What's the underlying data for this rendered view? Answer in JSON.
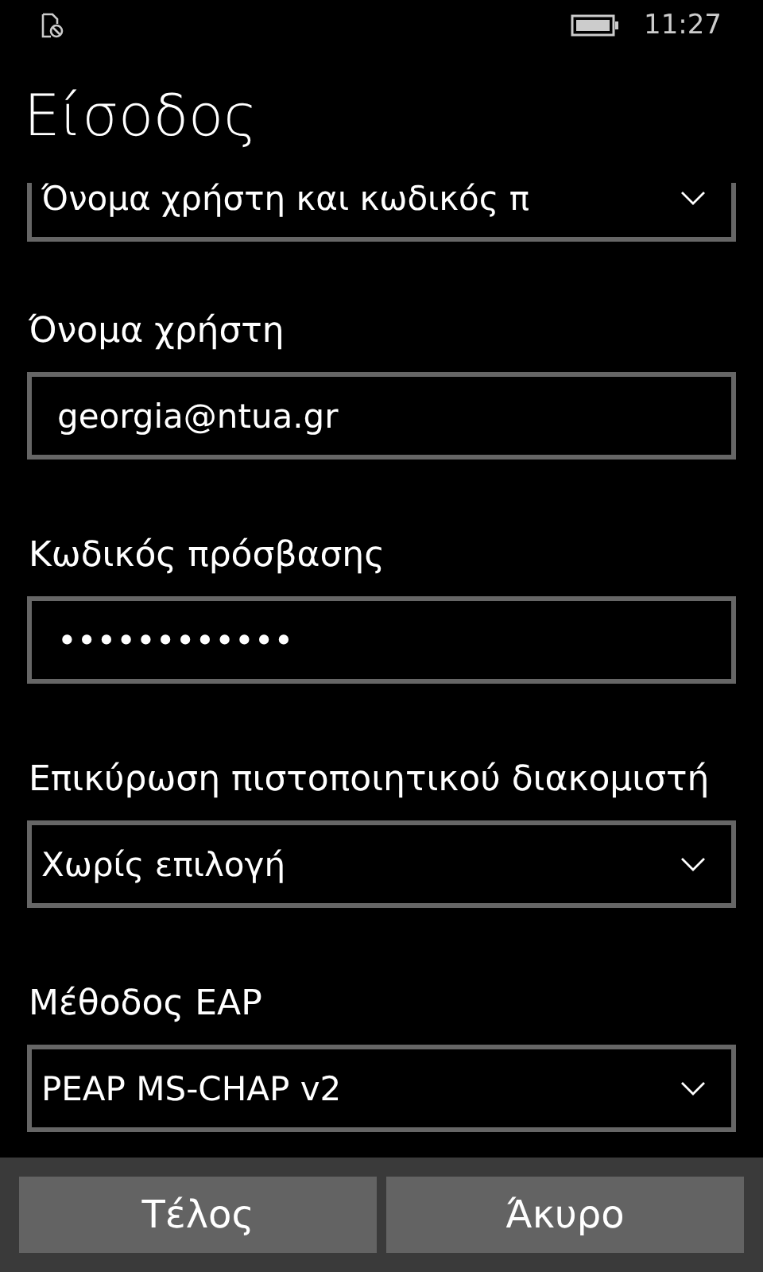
{
  "status_bar": {
    "time": "11:27"
  },
  "title": "Είσοδος",
  "fields": [
    {
      "kind": "cut_dropdown",
      "value": "Όνομα χρήστη και κωδικός π"
    },
    {
      "kind": "text",
      "label": "Όνομα χρήστη",
      "value": "georgia@ntua.gr"
    },
    {
      "kind": "text",
      "label": "Κωδικός πρόσβασης",
      "value": "••••••••••••"
    },
    {
      "kind": "dropdown",
      "label": "Επικύρωση πιστοποιητικού διακομιστή",
      "value": "Χωρίς επιλογή"
    },
    {
      "kind": "dropdown",
      "label": "Μέθοδος EAP",
      "value": "PEAP MS-CHAP v2"
    }
  ],
  "buttons": [
    "Τέλος",
    "Άκυρο"
  ]
}
